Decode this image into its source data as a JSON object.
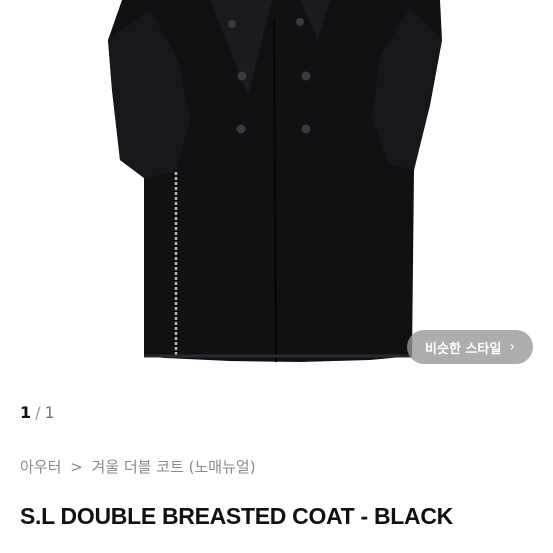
{
  "product_image": {
    "icon": "coat-photo",
    "caption": ""
  },
  "similar_style": {
    "label": "비슷한 스타일",
    "icon": "chevron-right-icon"
  },
  "image_counter": {
    "current": "1",
    "separator": "/",
    "total": "1"
  },
  "breadcrumb": {
    "category": "아우터",
    "separator": ">",
    "subcategory": "겨울 더블 코트 (노매뉴얼)"
  },
  "product": {
    "title": "S.L DOUBLE BREASTED COAT - BLACK"
  },
  "colors": {
    "coat": "#0f1012",
    "button_bg": "#969696",
    "text_primary": "#111111",
    "text_secondary": "#8a8a8a"
  }
}
